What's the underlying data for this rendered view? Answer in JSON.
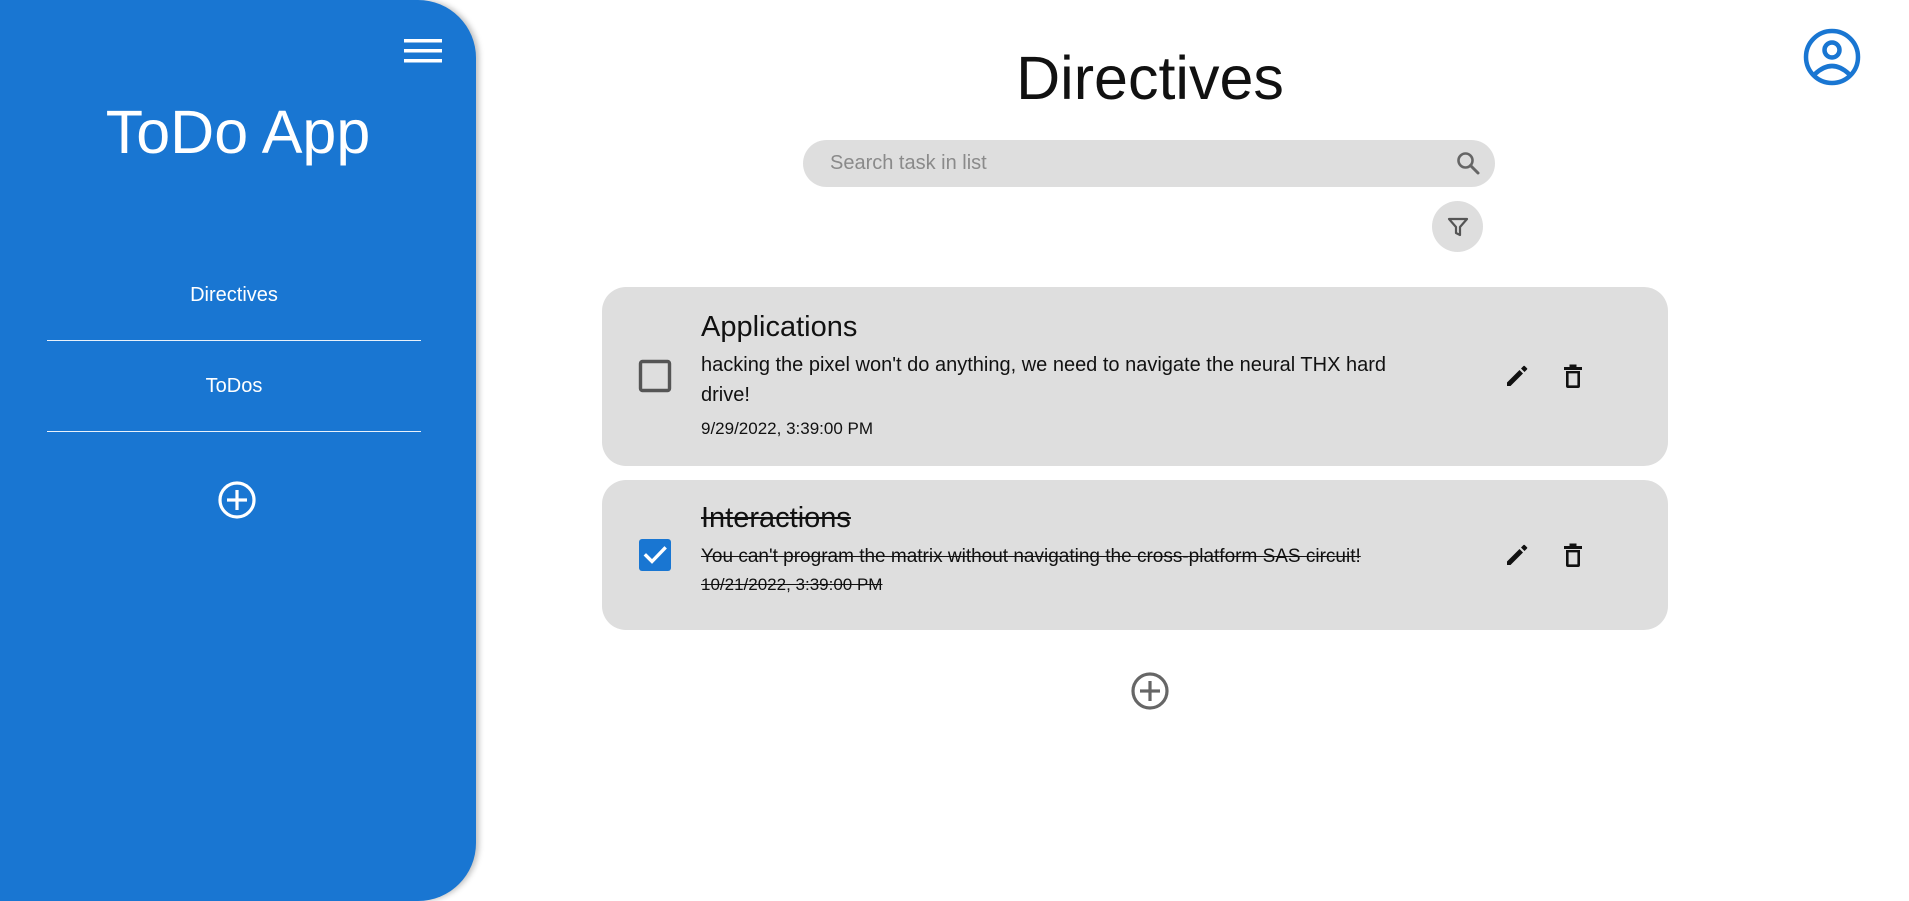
{
  "app": {
    "title": "ToDo App"
  },
  "sidebar": {
    "items": [
      {
        "label": "Directives"
      },
      {
        "label": "ToDos"
      }
    ]
  },
  "page": {
    "title": "Directives"
  },
  "search": {
    "placeholder": "Search task in list",
    "value": ""
  },
  "tasks": [
    {
      "title": "Applications",
      "description": "hacking the pixel won't do anything, we need to navigate the neural THX hard drive!",
      "date": "9/29/2022, 3:39:00 PM",
      "completed": false
    },
    {
      "title": "Interactions",
      "description": "You can't program the matrix without navigating the cross-platform SAS circuit!",
      "date": "10/21/2022, 3:39:00 PM",
      "completed": true
    }
  ],
  "icons": {
    "menu": "hamburger-menu-icon",
    "add": "add-circle-icon",
    "account": "account-circle-icon",
    "search": "search-icon",
    "filter": "filter-icon",
    "edit": "pencil-icon",
    "delete": "trash-icon"
  },
  "colors": {
    "primary": "#1976d2",
    "card_bg": "#dedede",
    "icon_gray": "#666666"
  }
}
